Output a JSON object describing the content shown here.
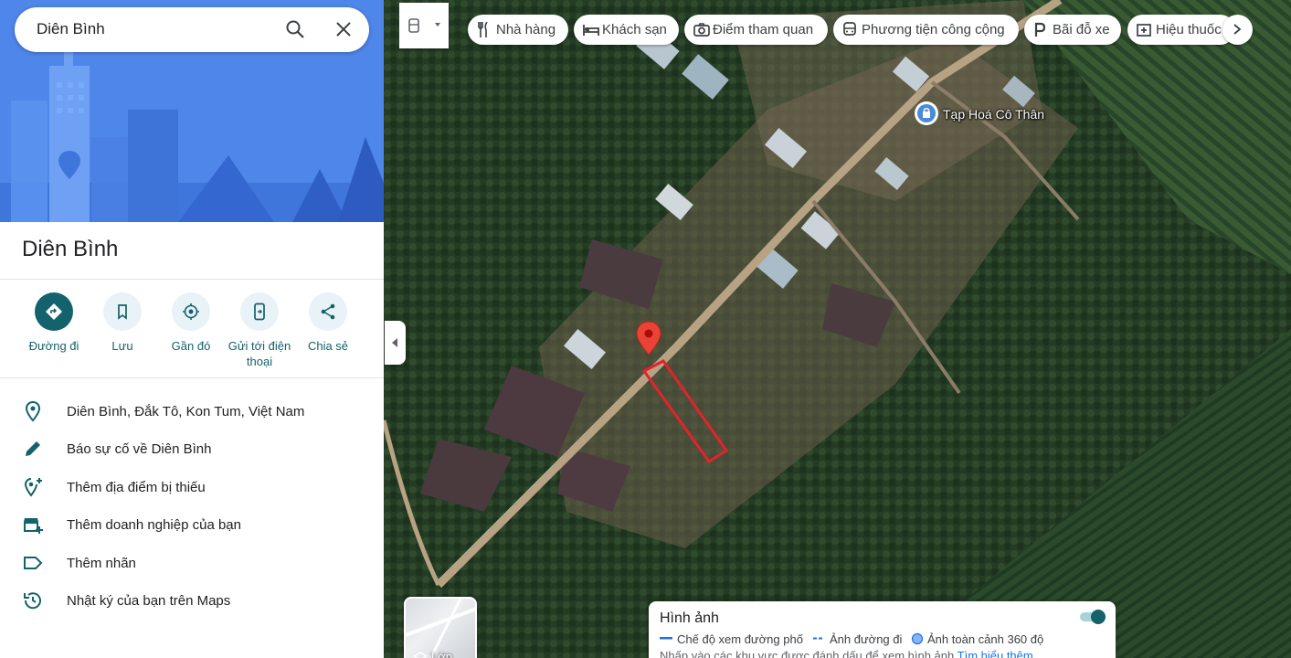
{
  "search": {
    "query": "Diên Bình"
  },
  "place": {
    "title": "Diên Bình"
  },
  "actions": [
    {
      "label": "Đường đi"
    },
    {
      "label": "Lưu"
    },
    {
      "label": "Gần đó"
    },
    {
      "label": "Gửi tới điện thoại"
    },
    {
      "label": "Chia sẻ"
    }
  ],
  "info_rows": [
    {
      "text": "Diên Bình, Đắk Tô, Kon Tum, Việt Nam",
      "icon": "location-pin-icon"
    },
    {
      "text": "Báo sự cố về Diên Bình",
      "icon": "pencil-icon"
    },
    {
      "text": "Thêm địa điểm bị thiếu",
      "icon": "add-place-icon"
    },
    {
      "text": "Thêm doanh nghiệp của bạn",
      "icon": "add-business-icon"
    },
    {
      "text": "Thêm nhãn",
      "icon": "label-icon"
    },
    {
      "text": "Nhật ký của bạn trên Maps",
      "icon": "history-icon"
    }
  ],
  "chips": [
    {
      "label": "Nhà hàng",
      "icon": "restaurant-icon"
    },
    {
      "label": "Khách sạn",
      "icon": "hotel-icon"
    },
    {
      "label": "Điểm tham quan",
      "icon": "camera-icon"
    },
    {
      "label": "Phương tiện công cộng",
      "icon": "transit-icon"
    },
    {
      "label": "Bãi đỗ xe",
      "icon": "parking-icon"
    },
    {
      "label": "Hiệu thuốc",
      "icon": "pharmacy-icon"
    }
  ],
  "map": {
    "poi": {
      "name": "Tạp Hoá Cô Thân",
      "icon": "shopping-bag-icon"
    },
    "layers_label": "Lớp"
  },
  "imagery": {
    "title": "Hình ảnh",
    "legend": [
      "Chế độ xem đường phố",
      "Ảnh đường đi",
      "Ảnh toàn cảnh 360 độ"
    ],
    "hint": "Nhấp vào các khu vực được đánh dấu để xem hình ảnh",
    "learn_more": "Tìm hiểu thêm",
    "toggle_on": true
  },
  "colors": {
    "accent": "#14626c",
    "hero": "#4f86ea",
    "pin": "#ea4335",
    "link": "#1a73e8"
  }
}
